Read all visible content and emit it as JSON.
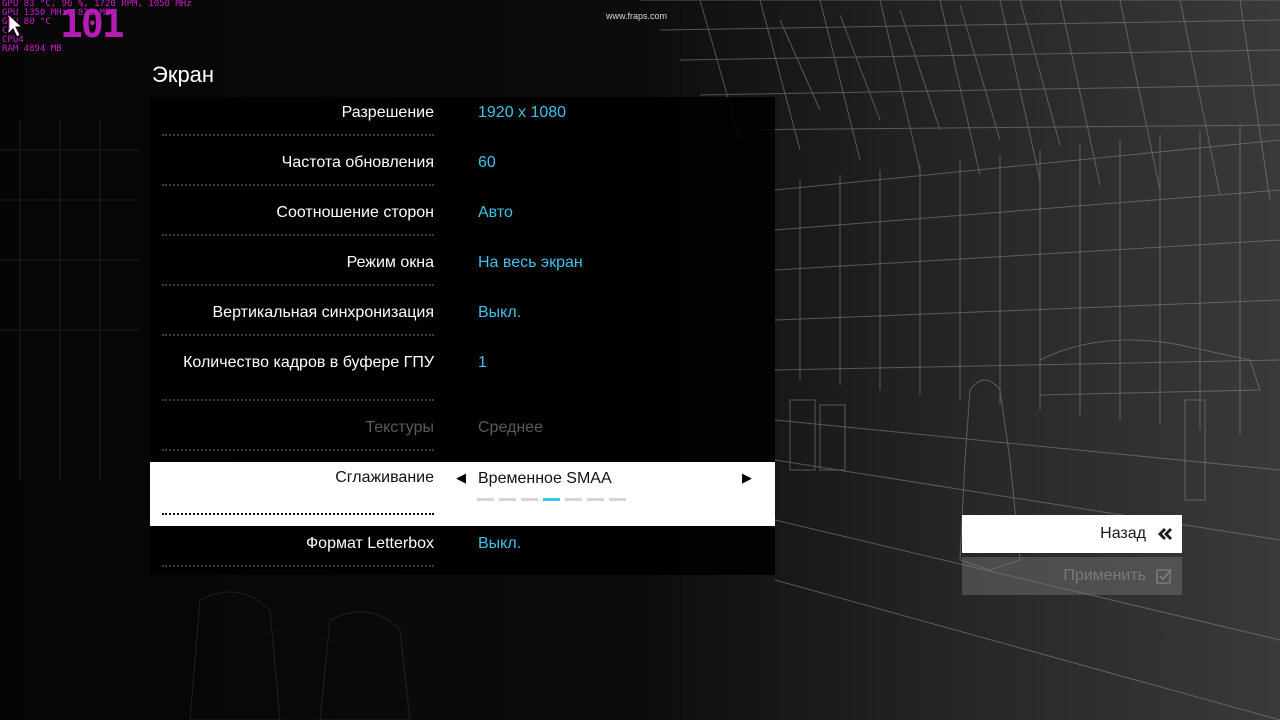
{
  "overlay": {
    "fraps_watermark": "www.fraps.com",
    "hud_lines": [
      "GPU      83 °C, 96 %, 1720 RPM, 1050 MHz",
      "GPU      1350 MHz, 831 MB",
      "GPU      80 °C",
      "CPU      ",
      "CPU4     ",
      "RAM      4894 MB"
    ],
    "fps_counter": "101"
  },
  "section": {
    "title": "Экран"
  },
  "settings": [
    {
      "label": "Разрешение",
      "value": "1920 x 1080"
    },
    {
      "label": "Частота обновления",
      "value": "60"
    },
    {
      "label": "Соотношение сторон",
      "value": "Авто"
    },
    {
      "label": "Режим окна",
      "value": "На весь экран"
    },
    {
      "label": "Вертикальная синхронизация",
      "value": "Выкл."
    },
    {
      "label": "Количество кадров в буфере ГПУ",
      "value": "1"
    },
    {
      "label": "Текстуры",
      "value": "Среднее",
      "disabled": true
    },
    {
      "label": "Сглаживание",
      "value": "Временное SMAA",
      "selected": true,
      "option_count": 7,
      "selected_option_index": 3
    },
    {
      "label": "Формат Letterbox",
      "value": "Выкл."
    }
  ],
  "buttons": {
    "back_label": "Назад",
    "apply_label": "Применить"
  },
  "icons": {
    "back": "double-chevron-left-icon",
    "apply": "checkbox-check-icon",
    "arrow_left": "triangle-left-icon",
    "arrow_right": "triangle-right-icon",
    "cursor": "mouse-cursor-icon"
  },
  "colors": {
    "value_accent": "#3fc3e6",
    "hud": "#c61fc6",
    "selected_row_bg": "#ffffff"
  }
}
